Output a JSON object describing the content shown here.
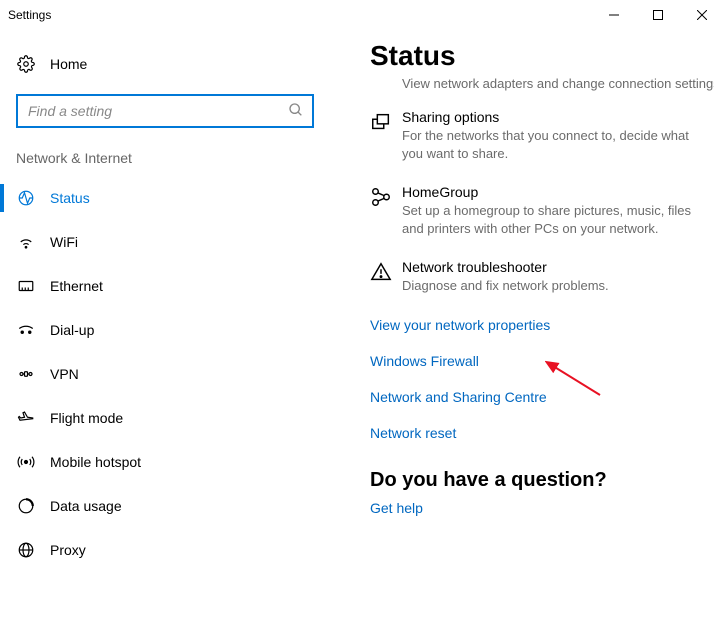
{
  "window": {
    "title": "Settings"
  },
  "sidebar": {
    "home": "Home",
    "search_placeholder": "Find a setting",
    "section": "Network & Internet",
    "items": [
      {
        "label": "Status"
      },
      {
        "label": "WiFi"
      },
      {
        "label": "Ethernet"
      },
      {
        "label": "Dial-up"
      },
      {
        "label": "VPN"
      },
      {
        "label": "Flight mode"
      },
      {
        "label": "Mobile hotspot"
      },
      {
        "label": "Data usage"
      },
      {
        "label": "Proxy"
      }
    ]
  },
  "main": {
    "title": "Status",
    "cutoff": "View network adapters and change connection settings.",
    "blocks": {
      "sharing": {
        "title": "Sharing options",
        "desc": "For the networks that you connect to, decide what you want to share."
      },
      "homegroup": {
        "title": "HomeGroup",
        "desc": "Set up a homegroup to share pictures, music, files and printers with other PCs on your network."
      },
      "troubleshooter": {
        "title": "Network troubleshooter",
        "desc": "Diagnose and fix network problems."
      }
    },
    "links": {
      "props": "View your network properties",
      "firewall": "Windows Firewall",
      "sharing_centre": "Network and Sharing Centre",
      "reset": "Network reset"
    },
    "question": "Do you have a question?",
    "help": "Get help"
  }
}
